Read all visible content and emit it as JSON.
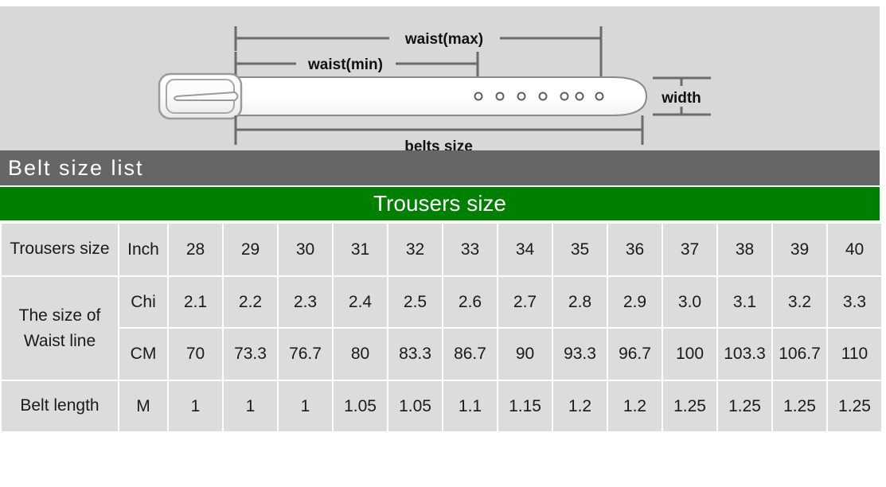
{
  "diagram": {
    "labels": {
      "waist_max": "waist(max)",
      "waist_min": "waist(min)",
      "belts_size": "belts size",
      "width": "width"
    },
    "hole_count": 7
  },
  "header": {
    "title": "Belt size  list",
    "section_title": "Trousers size"
  },
  "colors": {
    "title_bar": "#666666",
    "section_bar": "#008000",
    "cell_bg": "#dcdcdc",
    "diagram_bg": "#d8d8d8",
    "page_bg": "#ffffff"
  },
  "table": {
    "rows": [
      {
        "label": "Trousers size",
        "unit": "Inch",
        "values": [
          "28",
          "29",
          "30",
          "31",
          "32",
          "33",
          "34",
          "35",
          "36",
          "37",
          "38",
          "39",
          "40"
        ]
      },
      {
        "label": "The size of",
        "label2": "Waist line",
        "unit": "Chi",
        "values": [
          "2.1",
          "2.2",
          "2.3",
          "2.4",
          "2.5",
          "2.6",
          "2.7",
          "2.8",
          "2.9",
          "3.0",
          "3.1",
          "3.2",
          "3.3"
        ]
      },
      {
        "unit": "CM",
        "values": [
          "70",
          "73.3",
          "76.7",
          "80",
          "83.3",
          "86.7",
          "90",
          "93.3",
          "96.7",
          "100",
          "103.3",
          "106.7",
          "110"
        ]
      },
      {
        "label": "Belt length",
        "unit": "M",
        "values": [
          "1",
          "1",
          "1",
          "1.05",
          "1.05",
          "1.1",
          "1.15",
          "1.2",
          "1.2",
          "1.25",
          "1.25",
          "1.25",
          "1.25"
        ]
      }
    ]
  }
}
